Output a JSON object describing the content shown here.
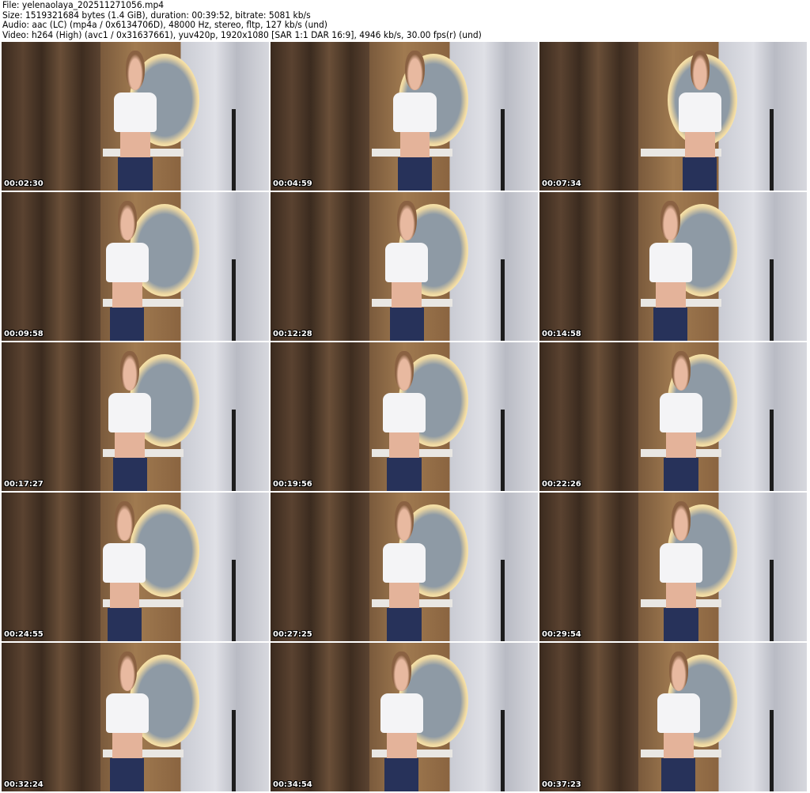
{
  "header": {
    "file": "File: yelenaolaya_202511271056.mp4",
    "size": "Size: 1519321684 bytes (1.4 GiB), duration: 00:39:52, bitrate: 5081 kb/s",
    "audio": "Audio: aac (LC) (mp4a / 0x6134706D), 48000 Hz, stereo, fltp, 127 kb/s (und)",
    "video": "Video: h264 (High) (avc1 / 0x31637661), yuv420p, 1920x1080 [SAR 1:1 DAR 16:9], 4946 kb/s, 30.00 fps(r) (und)"
  },
  "thumbnails": [
    {
      "timestamp": "00:02:30"
    },
    {
      "timestamp": "00:04:59"
    },
    {
      "timestamp": "00:07:34"
    },
    {
      "timestamp": "00:09:58"
    },
    {
      "timestamp": "00:12:28"
    },
    {
      "timestamp": "00:14:58"
    },
    {
      "timestamp": "00:17:27"
    },
    {
      "timestamp": "00:19:56"
    },
    {
      "timestamp": "00:22:26"
    },
    {
      "timestamp": "00:24:55"
    },
    {
      "timestamp": "00:27:25"
    },
    {
      "timestamp": "00:29:54"
    },
    {
      "timestamp": "00:32:24"
    },
    {
      "timestamp": "00:34:54"
    },
    {
      "timestamp": "00:37:23"
    }
  ]
}
